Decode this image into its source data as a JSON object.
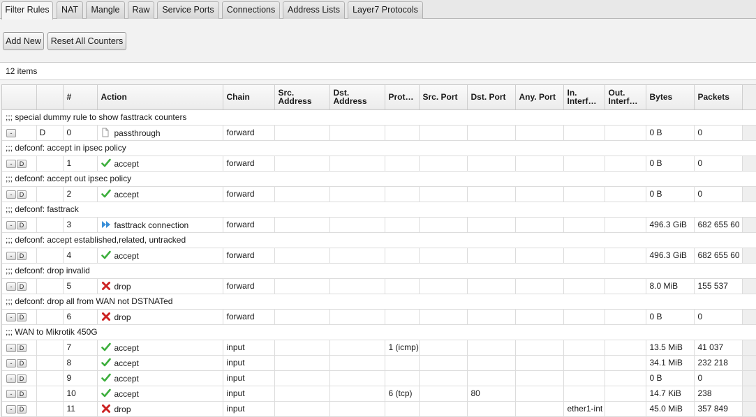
{
  "tabs": [
    {
      "label": "Filter Rules",
      "active": true
    },
    {
      "label": "NAT"
    },
    {
      "label": "Mangle"
    },
    {
      "label": "Raw"
    },
    {
      "label": "Service Ports"
    },
    {
      "label": "Connections"
    },
    {
      "label": "Address Lists"
    },
    {
      "label": "Layer7 Protocols"
    }
  ],
  "toolbar": {
    "add_new": "Add New",
    "reset_counters": "Reset All Counters"
  },
  "item_count": "12 items",
  "columns": {
    "hash": "#",
    "action": "Action",
    "chain": "Chain",
    "src_address_1": "Src.",
    "src_address_2": "Address",
    "dst_address_1": "Dst.",
    "dst_address_2": "Address",
    "protocol": "Prot…",
    "src_port": "Src. Port",
    "dst_port": "Dst. Port",
    "any_port": "Any. Port",
    "in_interface_1": "In.",
    "in_interface_2": "Interf…",
    "out_interface_1": "Out.",
    "out_interface_2": "Interf…",
    "bytes": "Bytes",
    "packets": "Packets"
  },
  "row_buttons": {
    "remove": "-",
    "disable": "D"
  },
  "action_icons": {
    "passthrough": "document-icon",
    "accept": "checkmark-icon",
    "fasttrack connection": "fast-forward-icon",
    "drop": "red-x-icon"
  },
  "colors": {
    "accept": "#3cae3c",
    "drop": "#cc2222",
    "fasttrack": "#3a8fd8"
  },
  "rows": [
    {
      "comment": ";;; special dummy rule to show fasttrack counters",
      "flag": "D",
      "num": "0",
      "action": "passthrough",
      "chain": "forward",
      "protocol": "",
      "dst_port": "",
      "in_interface": "",
      "bytes": "0 B",
      "packets": "0",
      "dynamic": true
    },
    {
      "comment": ";;; defconf: accept in ipsec policy",
      "num": "1",
      "action": "accept",
      "chain": "forward",
      "protocol": "",
      "dst_port": "",
      "in_interface": "",
      "bytes": "0 B",
      "packets": "0"
    },
    {
      "comment": ";;; defconf: accept out ipsec policy",
      "num": "2",
      "action": "accept",
      "chain": "forward",
      "protocol": "",
      "dst_port": "",
      "in_interface": "",
      "bytes": "0 B",
      "packets": "0"
    },
    {
      "comment": ";;; defconf: fasttrack",
      "num": "3",
      "action": "fasttrack connection",
      "chain": "forward",
      "protocol": "",
      "dst_port": "",
      "in_interface": "",
      "bytes": "496.3 GiB",
      "packets": "682 655 60"
    },
    {
      "comment": ";;; defconf: accept established,related, untracked",
      "num": "4",
      "action": "accept",
      "chain": "forward",
      "protocol": "",
      "dst_port": "",
      "in_interface": "",
      "bytes": "496.3 GiB",
      "packets": "682 655 60"
    },
    {
      "comment": ";;; defconf: drop invalid",
      "num": "5",
      "action": "drop",
      "chain": "forward",
      "protocol": "",
      "dst_port": "",
      "in_interface": "",
      "bytes": "8.0 MiB",
      "packets": "155 537"
    },
    {
      "comment": ";;; defconf: drop all from WAN not DSTNATed",
      "num": "6",
      "action": "drop",
      "chain": "forward",
      "protocol": "",
      "dst_port": "",
      "in_interface": "",
      "bytes": "0 B",
      "packets": "0"
    },
    {
      "comment": ";;; WAN to Mikrotik 450G",
      "num": "7",
      "action": "accept",
      "chain": "input",
      "protocol": "1 (icmp)",
      "dst_port": "",
      "in_interface": "",
      "bytes": "13.5 MiB",
      "packets": "41 037"
    },
    {
      "num": "8",
      "action": "accept",
      "chain": "input",
      "protocol": "",
      "dst_port": "",
      "in_interface": "",
      "bytes": "34.1 MiB",
      "packets": "232 218"
    },
    {
      "num": "9",
      "action": "accept",
      "chain": "input",
      "protocol": "",
      "dst_port": "",
      "in_interface": "",
      "bytes": "0 B",
      "packets": "0"
    },
    {
      "num": "10",
      "action": "accept",
      "chain": "input",
      "protocol": "6 (tcp)",
      "dst_port": "80",
      "in_interface": "",
      "bytes": "14.7 KiB",
      "packets": "238"
    },
    {
      "num": "11",
      "action": "drop",
      "chain": "input",
      "protocol": "",
      "dst_port": "",
      "in_interface": "ether1-int",
      "bytes": "45.0 MiB",
      "packets": "357 849"
    }
  ]
}
